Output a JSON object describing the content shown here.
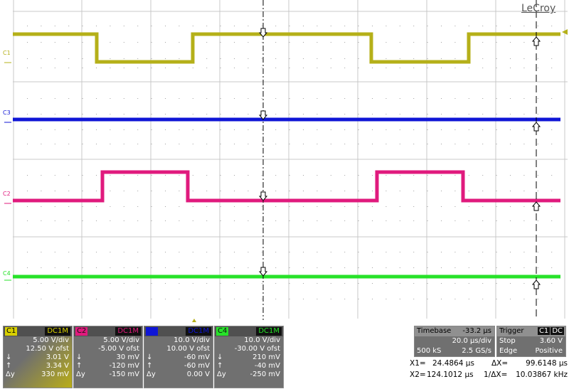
{
  "brand": "LeCroy",
  "traces": [
    {
      "id": "C1",
      "color": "#b5b019"
    },
    {
      "id": "C3",
      "color": "#0f16d6"
    },
    {
      "id": "C2",
      "color": "#e01a7d"
    },
    {
      "id": "C4",
      "color": "#27e229"
    }
  ],
  "channels": [
    {
      "name": "C1",
      "coupling": "DC1M",
      "color": "#d8d000",
      "vdiv": "5.00 V/div",
      "offset": "12.50 V ofst",
      "down": "↓",
      "down_val": "3.01 V",
      "up": "↑",
      "up_val": "3.34 V",
      "dy": "Δy",
      "dy_val": "330 mV"
    },
    {
      "name": "C2",
      "coupling": "DC1M",
      "color": "#e01a7d",
      "vdiv": "5.00 V/div",
      "offset": "-5.00 V ofst",
      "down": "↓",
      "down_val": "30 mV",
      "up": "↑",
      "up_val": "-120 mV",
      "dy": "Δy",
      "dy_val": "-150 mV"
    },
    {
      "name": "C3",
      "coupling": "DC1M",
      "color": "#0f16d6",
      "vdiv": "10.0 V/div",
      "offset": "10.00 V ofst",
      "down": "↓",
      "down_val": "-60 mV",
      "up": "↑",
      "up_val": "-60 mV",
      "dy": "Δy",
      "dy_val": "0.00 V"
    },
    {
      "name": "C4",
      "coupling": "DC1M",
      "color": "#27e229",
      "vdiv": "10.0 V/div",
      "offset": "-30.00 V ofst",
      "down": "↓",
      "down_val": "210 mV",
      "up": "↑",
      "up_val": "-40 mV",
      "dy": "Δy",
      "dy_val": "-250 mV"
    }
  ],
  "timebase": {
    "label": "Timebase",
    "delay": "-33.2 µs",
    "tdiv": "20.0 µs/div",
    "samples": "500 kS",
    "rate": "2.5 GS/s"
  },
  "trigger": {
    "label": "Trigger",
    "source": "C1",
    "coupling": "DC",
    "mode": "Stop",
    "level": "3.60 V",
    "type": "Edge",
    "slope": "Positive"
  },
  "measure": {
    "x1_label": "X1=",
    "x1": "24.4864 µs",
    "dx_label": "ΔX=",
    "dx": "99.6148 µs",
    "x2_label": "X2=",
    "x2": "124.1012 µs",
    "inv_label": "1/ΔX=",
    "inv": "10.03867 kHz"
  }
}
